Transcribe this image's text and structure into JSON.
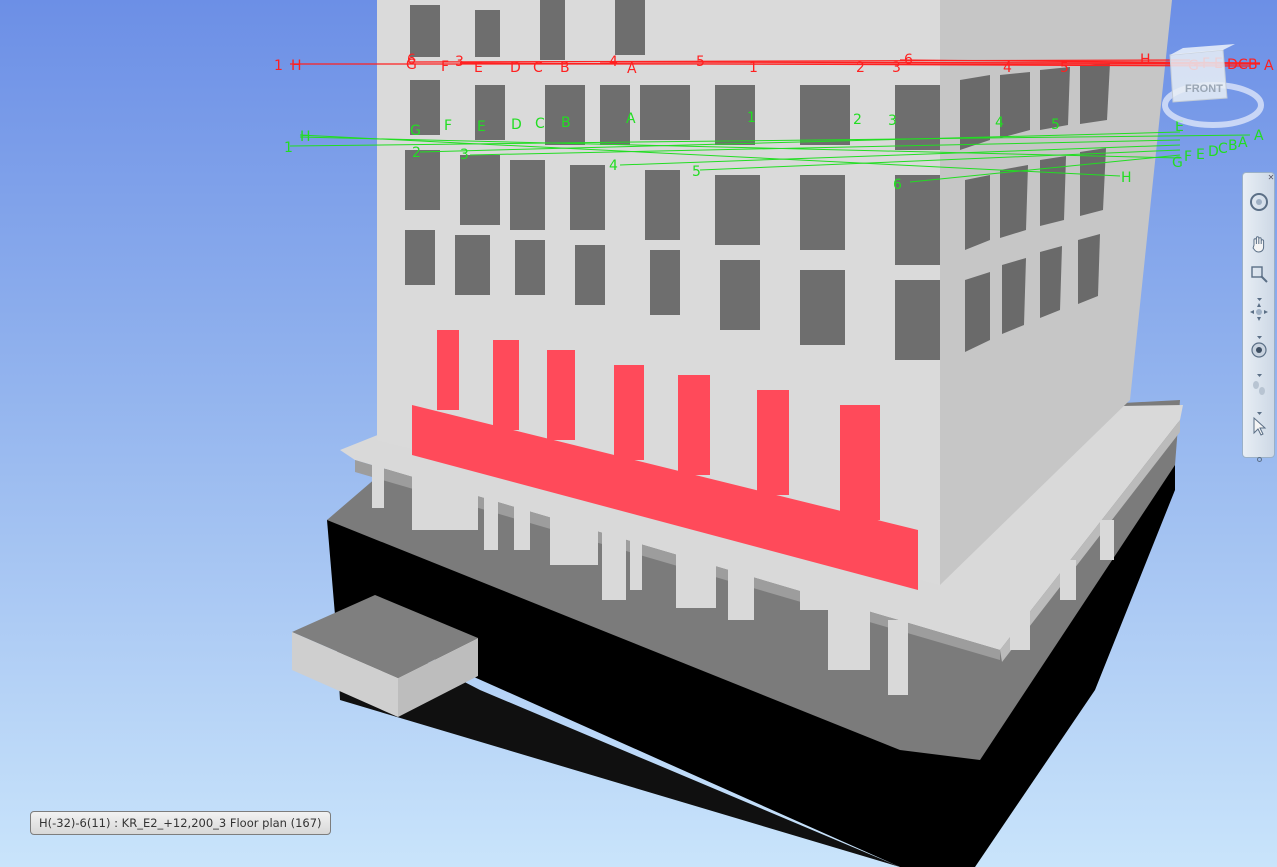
{
  "viewcube": {
    "face_label": "FRONT"
  },
  "status": {
    "text": "H(-32)-6(11) : KR_E2_+12,200_3 Floor plan (167)"
  },
  "navbar": {
    "tools": [
      {
        "name": "steering-wheel-icon"
      },
      {
        "name": "pan-icon"
      },
      {
        "name": "zoom-window-icon"
      },
      {
        "name": "orbit-icon"
      },
      {
        "name": "look-icon"
      },
      {
        "name": "walk-icon"
      },
      {
        "name": "select-icon"
      }
    ]
  },
  "grid_lines": {
    "red": {
      "color": "#ff2020",
      "labels": [
        "1",
        "H",
        "G",
        "6",
        "F",
        "3",
        "E",
        "D",
        "C",
        "B",
        "4",
        "A",
        "5",
        "1",
        "2",
        "3",
        "6",
        "4",
        "5",
        "H",
        "G",
        "F",
        "E",
        "D",
        "C",
        "B",
        "A"
      ]
    },
    "green": {
      "color": "#22dd22",
      "labels": [
        "1",
        "H",
        "G",
        "F",
        "E",
        "D",
        "C",
        "B",
        "A",
        "1",
        "2",
        "3",
        "4",
        "5",
        "2",
        "3",
        "4",
        "5",
        "6",
        "H",
        "G",
        "F",
        "E",
        "D",
        "C",
        "B",
        "A",
        "E",
        "A"
      ]
    }
  },
  "colors": {
    "sky_top": "#6c8fe6",
    "sky_bottom": "#c9e4fb",
    "concrete": "#d9d9d9",
    "highlight": "#ff4a5a",
    "foundation": "#000000"
  }
}
